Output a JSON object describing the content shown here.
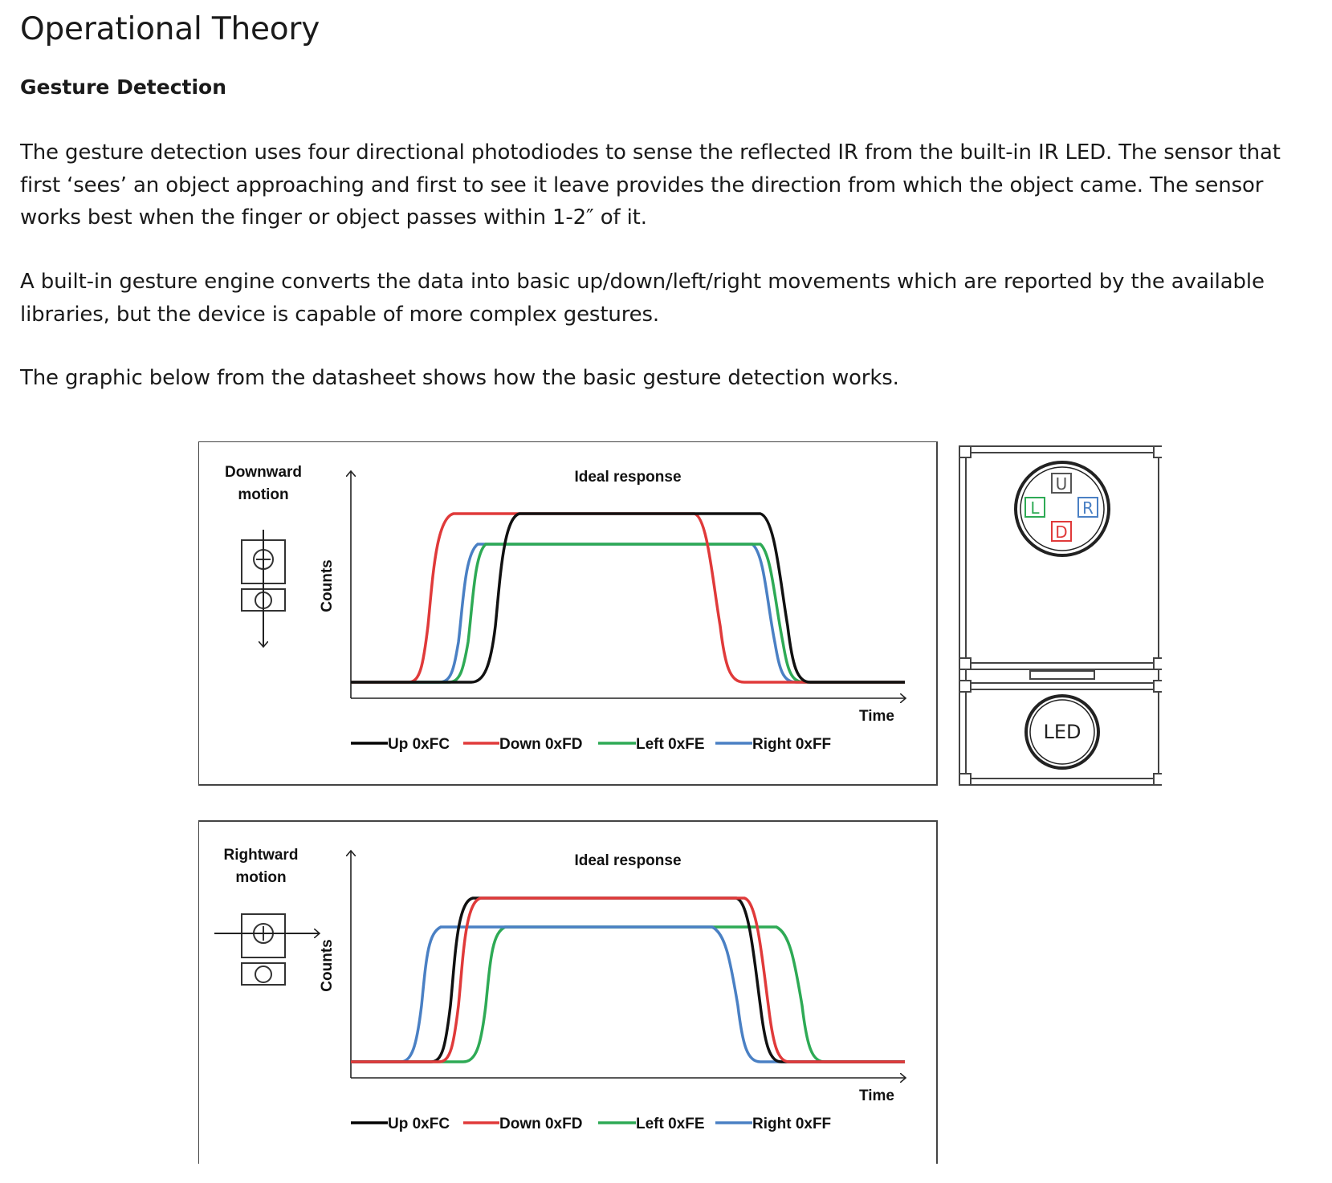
{
  "title": "Operational Theory",
  "section": "Gesture Detection",
  "paragraphs": [
    "The gesture detection uses four directional photodiodes to sense the reflected IR from the built-in IR LED.  The sensor that first ‘sees’ an object approaching and first to see it leave provides the direction from which the object came.  The sensor works best when the finger or object passes within 1-2″ of it.",
    "A built-in gesture engine converts the data into basic up/down/left/right movements which are reported by the available libraries, but the device is capable of more complex gestures.",
    "The graphic below from the datasheet shows how the basic gesture detection works."
  ],
  "figure": {
    "panels": [
      {
        "motion_line1": "Downward",
        "motion_line2": "motion",
        "heading": "Ideal response",
        "y_label": "Counts",
        "x_label": "Time"
      },
      {
        "motion_line1": "Rightward",
        "motion_line2": "motion",
        "heading": "Ideal response",
        "y_label": "Counts",
        "x_label": "Time"
      }
    ],
    "legend": [
      {
        "label": "Up 0xFC",
        "color": "#000000"
      },
      {
        "label": "Down 0xFD",
        "color": "#e03a3a"
      },
      {
        "label": "Left 0xFE",
        "color": "#2eaa55"
      },
      {
        "label": "Right 0xFF",
        "color": "#4a80c4"
      }
    ],
    "sensor": {
      "up": "U",
      "down": "D",
      "left": "L",
      "right": "R",
      "led": "LED"
    }
  }
}
